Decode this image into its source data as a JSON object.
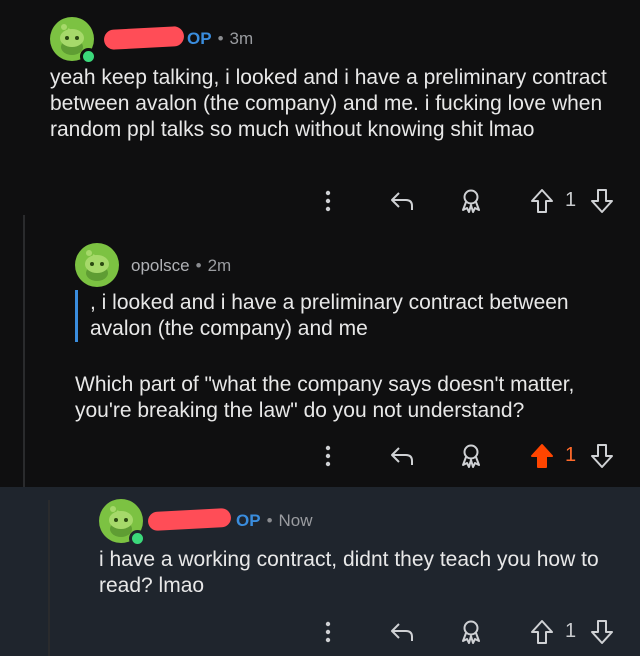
{
  "comments": [
    {
      "author_tag": "OP",
      "time": "3m",
      "body": "yeah keep talking, i looked and i have a preliminary contract between avalon (the company) and me. i fucking love when random ppl talks so much without knowing shit lmao",
      "score": "1",
      "upvoted": false
    },
    {
      "author": "opolsce",
      "time": "2m",
      "quote": ", i looked and i have a preliminary contract between avalon (the company) and me",
      "body": "Which part of \"what the company says doesn't matter, you're breaking the law\" do you not understand?",
      "score": "1",
      "upvoted": true
    },
    {
      "author_tag": "OP",
      "time": "Now",
      "body": "i have a working contract, didnt they teach you how to read? lmao",
      "score": "1",
      "upvoted": false
    }
  ],
  "separator": "•",
  "colors": {
    "background": "#0f0f10",
    "highlight": "#1f252d",
    "op": "#3a8dde",
    "upvote_active": "#ff4500",
    "avatar": "#7cc242",
    "online": "#3bd97b"
  },
  "icons": [
    "more-icon",
    "reply-icon",
    "award-icon",
    "upvote-icon",
    "downvote-icon"
  ]
}
